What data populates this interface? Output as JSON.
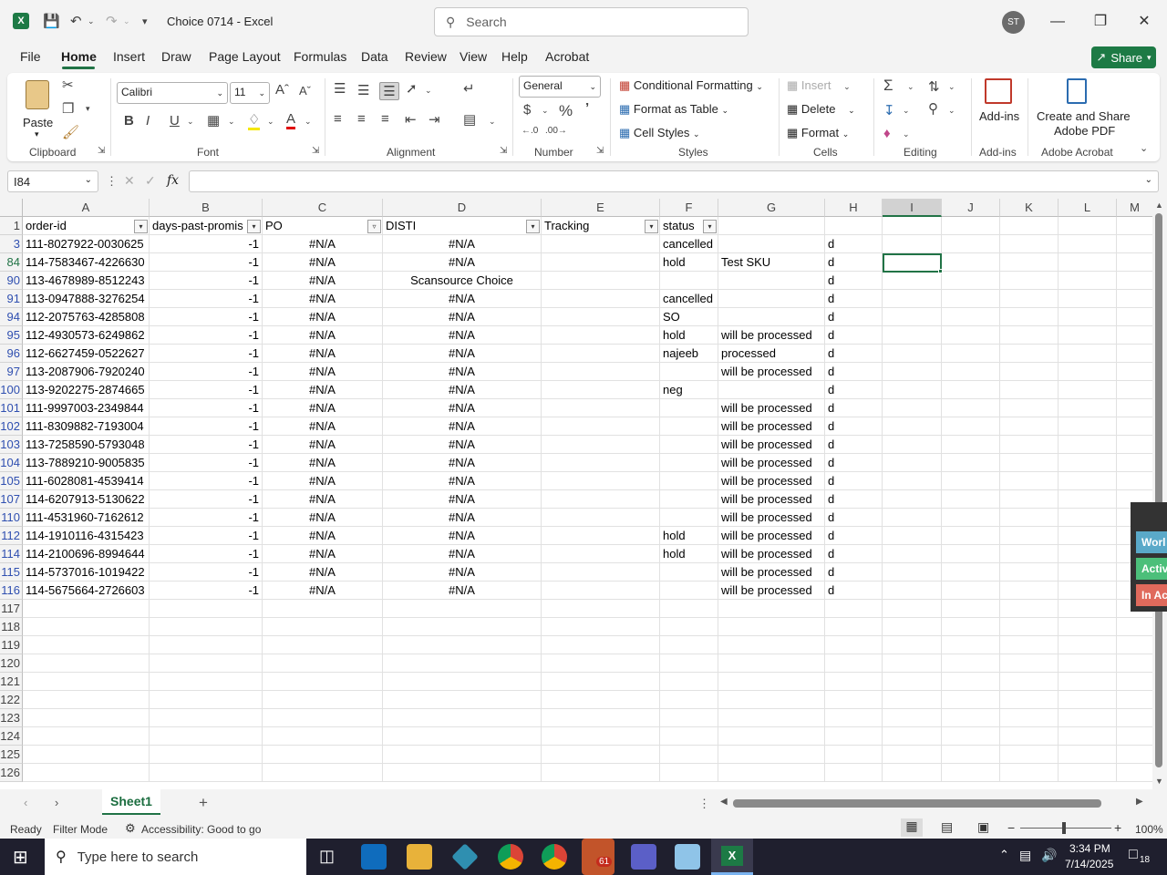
{
  "window": {
    "doc_title": "Choice 0714  -  Excel",
    "search_placeholder": "Search",
    "avatar_initials": "ST"
  },
  "menu": {
    "tabs": [
      "File",
      "Home",
      "Insert",
      "Draw",
      "Page Layout",
      "Formulas",
      "Data",
      "Review",
      "View",
      "Help",
      "Acrobat"
    ],
    "share": "Share"
  },
  "ribbon": {
    "paste": "Paste",
    "clipboard": "Clipboard",
    "font_name": "Calibri",
    "font_size": "11",
    "font_group": "Font",
    "alignment": "Alignment",
    "number_format": "General",
    "number_group": "Number",
    "conditional_formatting": "Conditional Formatting",
    "format_as_table": "Format as Table",
    "cell_styles": "Cell Styles",
    "styles_group": "Styles",
    "insert": "Insert",
    "delete": "Delete",
    "format": "Format",
    "cells_group": "Cells",
    "editing_group": "Editing",
    "addins": "Add-ins",
    "addins_group": "Add-ins",
    "create_share_1": "Create and Share",
    "create_share_2": "Adobe PDF",
    "acrobat_group": "Adobe Acrobat"
  },
  "formula_bar": {
    "name_box": "I84",
    "fx": "fx",
    "formula": ""
  },
  "columns": [
    "A",
    "B",
    "C",
    "D",
    "E",
    "F",
    "G",
    "H",
    "I",
    "J",
    "K",
    "L",
    "M"
  ],
  "headers": {
    "A": "order-id",
    "B": "days-past-promis",
    "C": "PO",
    "D": "DISTI",
    "E": "Tracking",
    "F": "status"
  },
  "rows": [
    {
      "num": "3",
      "A": "111-8027922-0030625",
      "B": "-1",
      "C": "#N/A",
      "D": "#N/A",
      "F": "cancelled",
      "G": "",
      "H": "d"
    },
    {
      "num": "84",
      "A": "114-7583467-4226630",
      "B": "-1",
      "C": "#N/A",
      "D": "#N/A",
      "F": "hold",
      "G": "Test SKU",
      "H": "d"
    },
    {
      "num": "90",
      "A": "113-4678989-8512243",
      "B": "-1",
      "C": "#N/A",
      "D": "Scansource Choice",
      "F": "",
      "G": "",
      "H": "d"
    },
    {
      "num": "91",
      "A": "113-0947888-3276254",
      "B": "-1",
      "C": "#N/A",
      "D": "#N/A",
      "F": "cancelled",
      "G": "",
      "H": "d"
    },
    {
      "num": "94",
      "A": "112-2075763-4285808",
      "B": "-1",
      "C": "#N/A",
      "D": "#N/A",
      "F": "SO",
      "G": "",
      "H": "d"
    },
    {
      "num": "95",
      "A": "112-4930573-6249862",
      "B": "-1",
      "C": "#N/A",
      "D": "#N/A",
      "F": "hold",
      "G": "will be processed",
      "H": "d"
    },
    {
      "num": "96",
      "A": "112-6627459-0522627",
      "B": "-1",
      "C": "#N/A",
      "D": "#N/A",
      "F": "najeeb",
      "G": "processed",
      "H": "d"
    },
    {
      "num": "97",
      "A": "113-2087906-7920240",
      "B": "-1",
      "C": "#N/A",
      "D": "#N/A",
      "F": "",
      "G": "will be processed",
      "H": "d"
    },
    {
      "num": "100",
      "A": "113-9202275-2874665",
      "B": "-1",
      "C": "#N/A",
      "D": "#N/A",
      "F": "neg",
      "G": "",
      "H": "d"
    },
    {
      "num": "101",
      "A": "111-9997003-2349844",
      "B": "-1",
      "C": "#N/A",
      "D": "#N/A",
      "F": "",
      "G": "will be processed",
      "H": "d"
    },
    {
      "num": "102",
      "A": "111-8309882-7193004",
      "B": "-1",
      "C": "#N/A",
      "D": "#N/A",
      "F": "",
      "G": "will be processed",
      "H": "d"
    },
    {
      "num": "103",
      "A": "113-7258590-5793048",
      "B": "-1",
      "C": "#N/A",
      "D": "#N/A",
      "F": "",
      "G": "will be processed",
      "H": "d"
    },
    {
      "num": "104",
      "A": "113-7889210-9005835",
      "B": "-1",
      "C": "#N/A",
      "D": "#N/A",
      "F": "",
      "G": "will be processed",
      "H": "d"
    },
    {
      "num": "105",
      "A": "111-6028081-4539414",
      "B": "-1",
      "C": "#N/A",
      "D": "#N/A",
      "F": "",
      "G": "will be processed",
      "H": "d"
    },
    {
      "num": "107",
      "A": "114-6207913-5130622",
      "B": "-1",
      "C": "#N/A",
      "D": "#N/A",
      "F": "",
      "G": "will be processed",
      "H": "d"
    },
    {
      "num": "110",
      "A": "111-4531960-7162612",
      "B": "-1",
      "C": "#N/A",
      "D": "#N/A",
      "F": "",
      "G": "will be processed",
      "H": "d"
    },
    {
      "num": "112",
      "A": "114-1910116-4315423",
      "B": "-1",
      "C": "#N/A",
      "D": "#N/A",
      "F": "hold",
      "G": "will be processed",
      "H": "d"
    },
    {
      "num": "114",
      "A": "114-2100696-8994644",
      "B": "-1",
      "C": "#N/A",
      "D": "#N/A",
      "F": "hold",
      "G": "will be processed",
      "H": "d"
    },
    {
      "num": "115",
      "A": "114-5737016-1019422",
      "B": "-1",
      "C": "#N/A",
      "D": "#N/A",
      "F": "",
      "G": "will be processed",
      "H": "d"
    },
    {
      "num": "116",
      "A": "114-5675664-2726603",
      "B": "-1",
      "C": "#N/A",
      "D": "#N/A",
      "F": "",
      "G": "will be processed",
      "H": "d"
    }
  ],
  "empty_rows": [
    "117",
    "118",
    "119",
    "120",
    "121",
    "122",
    "123",
    "124",
    "125",
    "126"
  ],
  "sheet": {
    "tab": "Sheet1"
  },
  "status": {
    "ready": "Ready",
    "filter_mode": "Filter Mode",
    "accessibility": "Accessibility: Good to go",
    "zoom": "100%"
  },
  "side_panel": [
    "Worl",
    "Activ",
    "In Ac"
  ],
  "taskbar": {
    "search": "Type here to search",
    "time": "3:34 PM",
    "date": "7/14/2025",
    "notif": "18",
    "badge": "61"
  }
}
